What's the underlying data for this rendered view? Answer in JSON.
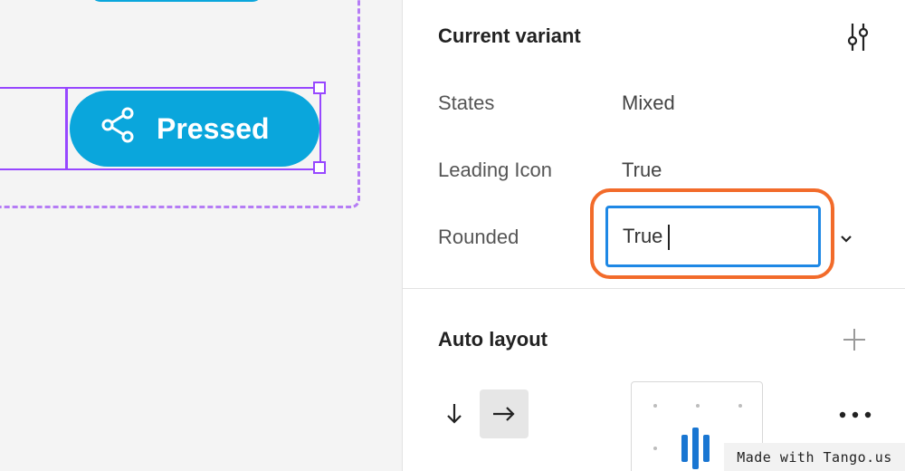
{
  "canvas": {
    "button_label": "Pressed"
  },
  "panel": {
    "current_variant": {
      "title": "Current variant",
      "properties": [
        {
          "label": "States",
          "value": "Mixed"
        },
        {
          "label": "Leading Icon",
          "value": "True"
        },
        {
          "label": "Rounded",
          "value": "True"
        }
      ]
    },
    "auto_layout": {
      "title": "Auto layout"
    }
  },
  "watermark": "Made with Tango.us",
  "colors": {
    "accent": "#0aa6dc",
    "selection": "#9747ff",
    "highlight": "#f26b2a",
    "input_focus": "#1e88e5"
  }
}
